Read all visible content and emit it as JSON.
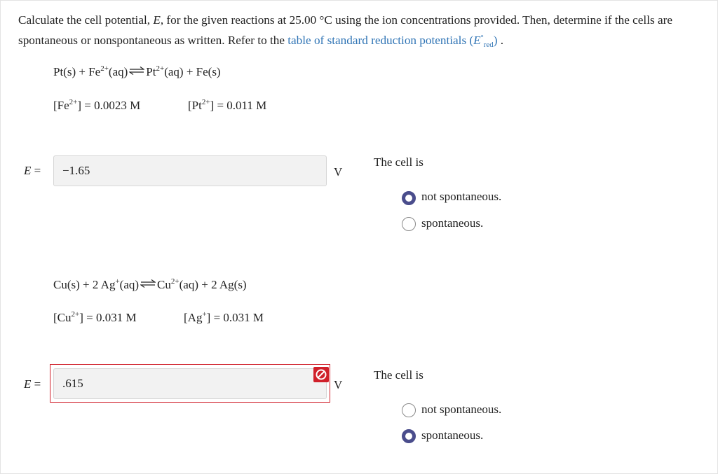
{
  "prompt": {
    "text": "Calculate the cell potential, E, for the given reactions at 25.00 °C using the ion concentrations provided. Then, determine if the cells are spontaneous or nonspontaneous as written. Refer to the",
    "link_text": "table of standard reduction potentials (E°red)",
    "end": " ."
  },
  "problem1": {
    "reaction": "Pt(s) + Fe2+(aq) ⇌ Pt2+(aq) + Fe(s)",
    "conc_fe": "[Fe2+] = 0.0023 M",
    "conc_pt": "[Pt2+] = 0.011 M",
    "e_label": "E =",
    "e_value": "−1.65",
    "unit": "V",
    "cell_is": "The cell is",
    "options": [
      {
        "label": "not spontaneous.",
        "selected": true
      },
      {
        "label": "spontaneous.",
        "selected": false
      }
    ]
  },
  "problem2": {
    "reaction": "Cu(s) + 2 Ag+(aq) ⇌ Cu2+(aq) + 2 Ag(s)",
    "conc_cu": "[Cu2+] = 0.031 M",
    "conc_ag": "[Ag+] = 0.031 M",
    "e_label": "E =",
    "e_value": ".615",
    "unit": "V",
    "status": "incorrect",
    "cell_is": "The cell is",
    "options": [
      {
        "label": "not spontaneous.",
        "selected": false
      },
      {
        "label": "spontaneous.",
        "selected": true
      }
    ]
  },
  "colors": {
    "link": "#2f74b5",
    "error": "#d0202a",
    "radio_selected": "#4a4d8c"
  }
}
